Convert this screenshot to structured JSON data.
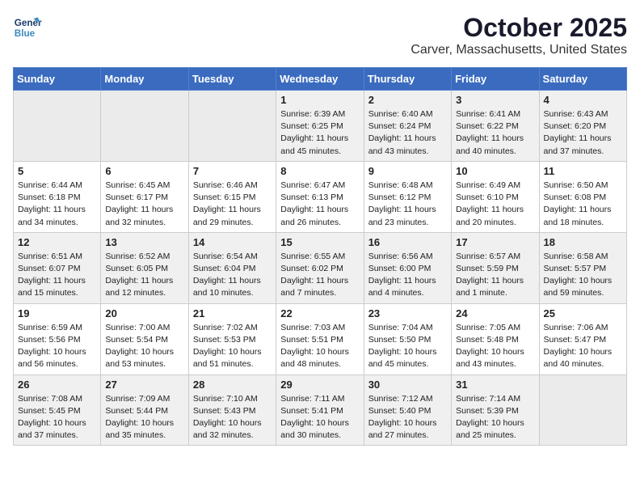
{
  "header": {
    "logo_line1": "General",
    "logo_line2": "Blue",
    "month": "October 2025",
    "location": "Carver, Massachusetts, United States"
  },
  "weekdays": [
    "Sunday",
    "Monday",
    "Tuesday",
    "Wednesday",
    "Thursday",
    "Friday",
    "Saturday"
  ],
  "weeks": [
    [
      {
        "day": "",
        "info": ""
      },
      {
        "day": "",
        "info": ""
      },
      {
        "day": "",
        "info": ""
      },
      {
        "day": "1",
        "info": "Sunrise: 6:39 AM\nSunset: 6:25 PM\nDaylight: 11 hours\nand 45 minutes."
      },
      {
        "day": "2",
        "info": "Sunrise: 6:40 AM\nSunset: 6:24 PM\nDaylight: 11 hours\nand 43 minutes."
      },
      {
        "day": "3",
        "info": "Sunrise: 6:41 AM\nSunset: 6:22 PM\nDaylight: 11 hours\nand 40 minutes."
      },
      {
        "day": "4",
        "info": "Sunrise: 6:43 AM\nSunset: 6:20 PM\nDaylight: 11 hours\nand 37 minutes."
      }
    ],
    [
      {
        "day": "5",
        "info": "Sunrise: 6:44 AM\nSunset: 6:18 PM\nDaylight: 11 hours\nand 34 minutes."
      },
      {
        "day": "6",
        "info": "Sunrise: 6:45 AM\nSunset: 6:17 PM\nDaylight: 11 hours\nand 32 minutes."
      },
      {
        "day": "7",
        "info": "Sunrise: 6:46 AM\nSunset: 6:15 PM\nDaylight: 11 hours\nand 29 minutes."
      },
      {
        "day": "8",
        "info": "Sunrise: 6:47 AM\nSunset: 6:13 PM\nDaylight: 11 hours\nand 26 minutes."
      },
      {
        "day": "9",
        "info": "Sunrise: 6:48 AM\nSunset: 6:12 PM\nDaylight: 11 hours\nand 23 minutes."
      },
      {
        "day": "10",
        "info": "Sunrise: 6:49 AM\nSunset: 6:10 PM\nDaylight: 11 hours\nand 20 minutes."
      },
      {
        "day": "11",
        "info": "Sunrise: 6:50 AM\nSunset: 6:08 PM\nDaylight: 11 hours\nand 18 minutes."
      }
    ],
    [
      {
        "day": "12",
        "info": "Sunrise: 6:51 AM\nSunset: 6:07 PM\nDaylight: 11 hours\nand 15 minutes."
      },
      {
        "day": "13",
        "info": "Sunrise: 6:52 AM\nSunset: 6:05 PM\nDaylight: 11 hours\nand 12 minutes."
      },
      {
        "day": "14",
        "info": "Sunrise: 6:54 AM\nSunset: 6:04 PM\nDaylight: 11 hours\nand 10 minutes."
      },
      {
        "day": "15",
        "info": "Sunrise: 6:55 AM\nSunset: 6:02 PM\nDaylight: 11 hours\nand 7 minutes."
      },
      {
        "day": "16",
        "info": "Sunrise: 6:56 AM\nSunset: 6:00 PM\nDaylight: 11 hours\nand 4 minutes."
      },
      {
        "day": "17",
        "info": "Sunrise: 6:57 AM\nSunset: 5:59 PM\nDaylight: 11 hours\nand 1 minute."
      },
      {
        "day": "18",
        "info": "Sunrise: 6:58 AM\nSunset: 5:57 PM\nDaylight: 10 hours\nand 59 minutes."
      }
    ],
    [
      {
        "day": "19",
        "info": "Sunrise: 6:59 AM\nSunset: 5:56 PM\nDaylight: 10 hours\nand 56 minutes."
      },
      {
        "day": "20",
        "info": "Sunrise: 7:00 AM\nSunset: 5:54 PM\nDaylight: 10 hours\nand 53 minutes."
      },
      {
        "day": "21",
        "info": "Sunrise: 7:02 AM\nSunset: 5:53 PM\nDaylight: 10 hours\nand 51 minutes."
      },
      {
        "day": "22",
        "info": "Sunrise: 7:03 AM\nSunset: 5:51 PM\nDaylight: 10 hours\nand 48 minutes."
      },
      {
        "day": "23",
        "info": "Sunrise: 7:04 AM\nSunset: 5:50 PM\nDaylight: 10 hours\nand 45 minutes."
      },
      {
        "day": "24",
        "info": "Sunrise: 7:05 AM\nSunset: 5:48 PM\nDaylight: 10 hours\nand 43 minutes."
      },
      {
        "day": "25",
        "info": "Sunrise: 7:06 AM\nSunset: 5:47 PM\nDaylight: 10 hours\nand 40 minutes."
      }
    ],
    [
      {
        "day": "26",
        "info": "Sunrise: 7:08 AM\nSunset: 5:45 PM\nDaylight: 10 hours\nand 37 minutes."
      },
      {
        "day": "27",
        "info": "Sunrise: 7:09 AM\nSunset: 5:44 PM\nDaylight: 10 hours\nand 35 minutes."
      },
      {
        "day": "28",
        "info": "Sunrise: 7:10 AM\nSunset: 5:43 PM\nDaylight: 10 hours\nand 32 minutes."
      },
      {
        "day": "29",
        "info": "Sunrise: 7:11 AM\nSunset: 5:41 PM\nDaylight: 10 hours\nand 30 minutes."
      },
      {
        "day": "30",
        "info": "Sunrise: 7:12 AM\nSunset: 5:40 PM\nDaylight: 10 hours\nand 27 minutes."
      },
      {
        "day": "31",
        "info": "Sunrise: 7:14 AM\nSunset: 5:39 PM\nDaylight: 10 hours\nand 25 minutes."
      },
      {
        "day": "",
        "info": ""
      }
    ]
  ]
}
